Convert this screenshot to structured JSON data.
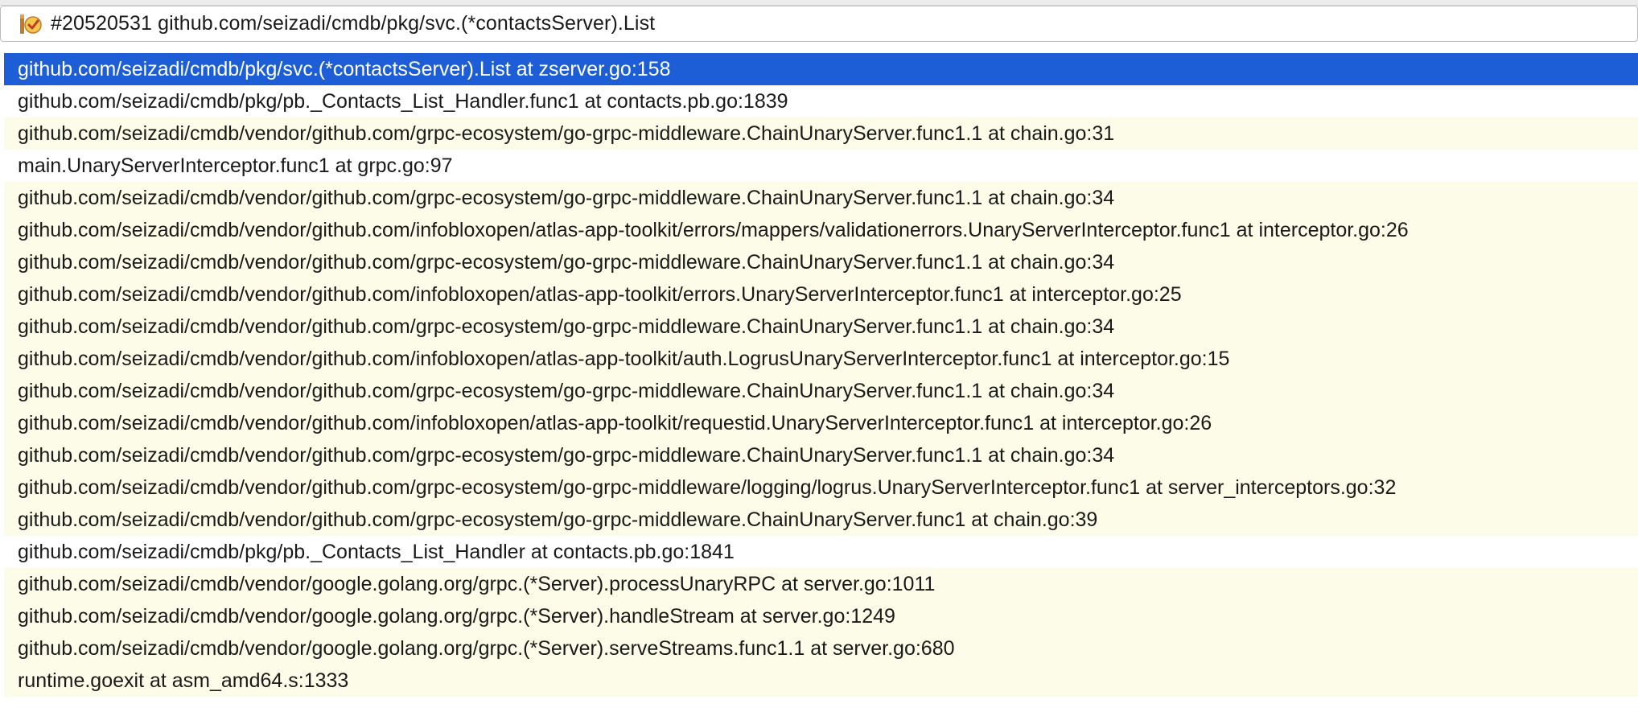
{
  "colors": {
    "selection": "#1d5ed6",
    "library_row": "#fcfce8",
    "project_row": "#ffffff",
    "text": "#1a1a1a"
  },
  "goroutine_selector": {
    "icon": "goroutine-icon",
    "label": "#20520531 github.com/seizadi/cmdb/pkg/svc.(*contactsServer).List"
  },
  "frames": [
    {
      "text": "github.com/seizadi/cmdb/pkg/svc.(*contactsServer).List at zserver.go:158",
      "kind": "selected"
    },
    {
      "text": "github.com/seizadi/cmdb/pkg/pb._Contacts_List_Handler.func1 at contacts.pb.go:1839",
      "kind": "project"
    },
    {
      "text": "github.com/seizadi/cmdb/vendor/github.com/grpc-ecosystem/go-grpc-middleware.ChainUnaryServer.func1.1 at chain.go:31",
      "kind": "library"
    },
    {
      "text": "main.UnaryServerInterceptor.func1 at grpc.go:97",
      "kind": "project"
    },
    {
      "text": "github.com/seizadi/cmdb/vendor/github.com/grpc-ecosystem/go-grpc-middleware.ChainUnaryServer.func1.1 at chain.go:34",
      "kind": "library"
    },
    {
      "text": "github.com/seizadi/cmdb/vendor/github.com/infobloxopen/atlas-app-toolkit/errors/mappers/validationerrors.UnaryServerInterceptor.func1 at interceptor.go:26",
      "kind": "library"
    },
    {
      "text": "github.com/seizadi/cmdb/vendor/github.com/grpc-ecosystem/go-grpc-middleware.ChainUnaryServer.func1.1 at chain.go:34",
      "kind": "library"
    },
    {
      "text": "github.com/seizadi/cmdb/vendor/github.com/infobloxopen/atlas-app-toolkit/errors.UnaryServerInterceptor.func1 at interceptor.go:25",
      "kind": "library"
    },
    {
      "text": "github.com/seizadi/cmdb/vendor/github.com/grpc-ecosystem/go-grpc-middleware.ChainUnaryServer.func1.1 at chain.go:34",
      "kind": "library"
    },
    {
      "text": "github.com/seizadi/cmdb/vendor/github.com/infobloxopen/atlas-app-toolkit/auth.LogrusUnaryServerInterceptor.func1 at interceptor.go:15",
      "kind": "library"
    },
    {
      "text": "github.com/seizadi/cmdb/vendor/github.com/grpc-ecosystem/go-grpc-middleware.ChainUnaryServer.func1.1 at chain.go:34",
      "kind": "library"
    },
    {
      "text": "github.com/seizadi/cmdb/vendor/github.com/infobloxopen/atlas-app-toolkit/requestid.UnaryServerInterceptor.func1 at interceptor.go:26",
      "kind": "library"
    },
    {
      "text": "github.com/seizadi/cmdb/vendor/github.com/grpc-ecosystem/go-grpc-middleware.ChainUnaryServer.func1.1 at chain.go:34",
      "kind": "library"
    },
    {
      "text": "github.com/seizadi/cmdb/vendor/github.com/grpc-ecosystem/go-grpc-middleware/logging/logrus.UnaryServerInterceptor.func1 at server_interceptors.go:32",
      "kind": "library"
    },
    {
      "text": "github.com/seizadi/cmdb/vendor/github.com/grpc-ecosystem/go-grpc-middleware.ChainUnaryServer.func1 at chain.go:39",
      "kind": "library"
    },
    {
      "text": "github.com/seizadi/cmdb/pkg/pb._Contacts_List_Handler at contacts.pb.go:1841",
      "kind": "project"
    },
    {
      "text": "github.com/seizadi/cmdb/vendor/google.golang.org/grpc.(*Server).processUnaryRPC at server.go:1011",
      "kind": "library"
    },
    {
      "text": "github.com/seizadi/cmdb/vendor/google.golang.org/grpc.(*Server).handleStream at server.go:1249",
      "kind": "library"
    },
    {
      "text": "github.com/seizadi/cmdb/vendor/google.golang.org/grpc.(*Server).serveStreams.func1.1 at server.go:680",
      "kind": "library"
    },
    {
      "text": "runtime.goexit at asm_amd64.s:1333",
      "kind": "library"
    }
  ]
}
